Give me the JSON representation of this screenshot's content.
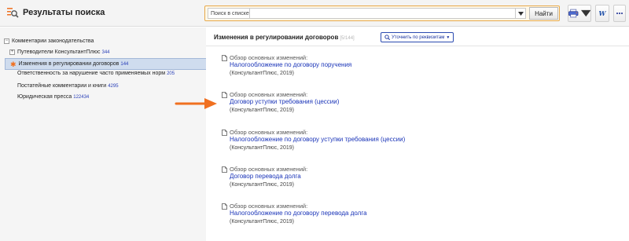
{
  "header": {
    "title": "Результаты поиска",
    "search_label": "Поиск в списке",
    "search_value": "",
    "search_button": "Найти",
    "word_glyph": "W"
  },
  "tree": {
    "root_label": "Комментарии законодательства",
    "root_toggle": "−",
    "items": [
      {
        "label": "Путеводители КонсультантПлюс",
        "count": "344",
        "toggle": "+"
      },
      {
        "label": "Изменения в регулировании договоров",
        "count": "144",
        "selected": true
      },
      {
        "label": "Ответственность за нарушение часто применяемых норм",
        "count": "205"
      },
      {
        "label": "Постатейные комментарии и книги",
        "count": "4295"
      },
      {
        "label": "Юридическая пресса",
        "count": "122434"
      }
    ]
  },
  "content": {
    "title": "Изменения в регулировании договоров",
    "count": "[5/144]",
    "refine_label": "Уточнить по реквизитам",
    "results": [
      {
        "label": "Обзор основных изменений:",
        "link": "Налогообложение по договору поручения",
        "source": "(КонсультантПлюс, 2019)"
      },
      {
        "label": "Обзор основных изменений:",
        "link": "Договор уступки требования (цессии)",
        "source": "(КонсультантПлюс, 2019)"
      },
      {
        "label": "Обзор основных изменений:",
        "link": "Налогообложение по договору уступки требования (цессии)",
        "source": "(КонсультантПлюс, 2019)"
      },
      {
        "label": "Обзор основных изменений:",
        "link": "Договор перевода долга",
        "source": "(КонсультантПлюс, 2019)"
      },
      {
        "label": "Обзор основных изменений:",
        "link": "Налогообложение по договору перевода долга",
        "source": "(КонсультантПлюс, 2019)"
      }
    ]
  },
  "icons": {
    "app": "search-results-icon",
    "document": "document-icon",
    "selected_marker": "star-icon",
    "print": "printer-icon",
    "word": "word-icon",
    "more": "more-icon",
    "refine": "magnifier-icon"
  },
  "colors": {
    "accent_orange": "#f07020",
    "link_blue": "#1a34b8",
    "selection_bg": "#cfdcee",
    "search_border": "#e6a84a"
  }
}
